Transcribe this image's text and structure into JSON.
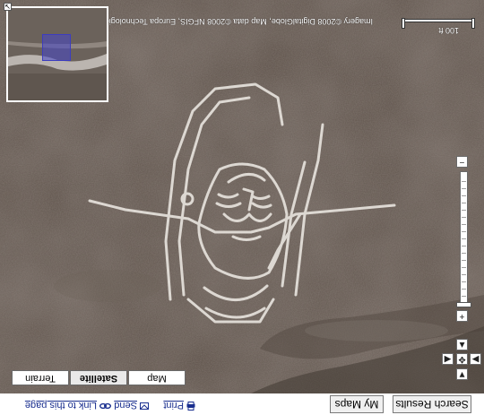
{
  "toolbar": {
    "search_results": "Search Results",
    "my_maps": "My Maps",
    "print": "Print",
    "send": "Send",
    "link": "Link to this page"
  },
  "map_types": {
    "map": "Map",
    "satellite": "Satellite",
    "terrain": "Terrain",
    "active": "Satellite"
  },
  "attribution": "Imagery ©2008 DigitalGlobe, Map data ©2008 NFGIS, Europa Technologies, AND - Terms of Use",
  "scale_label": "100 ft",
  "controls": {
    "pan_up": "▲",
    "pan_down": "▼",
    "pan_left": "◀",
    "pan_right": "▶",
    "center": "✥",
    "zoom_in": "+",
    "zoom_out": "−"
  },
  "colors": {
    "ground": "#5a4e46",
    "outline": "#e6e2dc",
    "overview_box": "#3d3dbe"
  }
}
